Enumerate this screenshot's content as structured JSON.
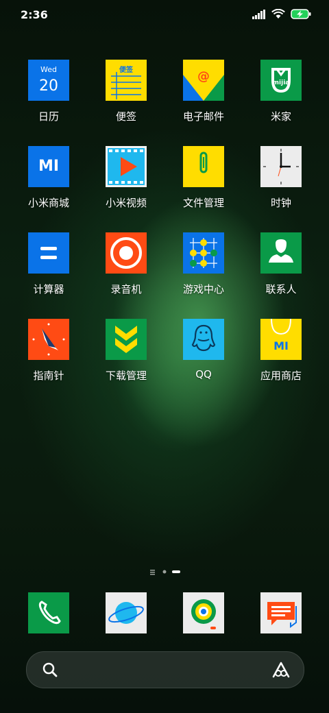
{
  "status": {
    "time": "2:36"
  },
  "apps": [
    {
      "label": "日历",
      "icon": "calendar-icon",
      "day": "Wed",
      "date": "20"
    },
    {
      "label": "便签",
      "icon": "notes-icon",
      "tag": "便签"
    },
    {
      "label": "电子邮件",
      "icon": "email-icon"
    },
    {
      "label": "米家",
      "icon": "mijia-icon",
      "tag": "mijia"
    },
    {
      "label": "小米商城",
      "icon": "mi-store-icon",
      "tag": "MI"
    },
    {
      "label": "小米视频",
      "icon": "video-icon"
    },
    {
      "label": "文件管理",
      "icon": "file-manager-icon"
    },
    {
      "label": "时钟",
      "icon": "clock-icon"
    },
    {
      "label": "计算器",
      "icon": "calculator-icon"
    },
    {
      "label": "录音机",
      "icon": "recorder-icon"
    },
    {
      "label": "游戏中心",
      "icon": "game-center-icon"
    },
    {
      "label": "联系人",
      "icon": "contacts-icon"
    },
    {
      "label": "指南针",
      "icon": "compass-icon"
    },
    {
      "label": "下载管理",
      "icon": "download-icon"
    },
    {
      "label": "QQ",
      "icon": "qq-icon"
    },
    {
      "label": "应用商店",
      "icon": "app-store-icon",
      "tag": "MI"
    }
  ],
  "dock": [
    {
      "icon": "phone-icon"
    },
    {
      "icon": "browser-icon"
    },
    {
      "icon": "camera-icon"
    },
    {
      "icon": "messages-icon"
    }
  ],
  "colors": {
    "blue": "#0a73e8",
    "yellow": "#ffdd00",
    "green": "#0a9a48",
    "orange": "#ff4b14",
    "cyan": "#1fb8ee",
    "light": "#ececec"
  }
}
